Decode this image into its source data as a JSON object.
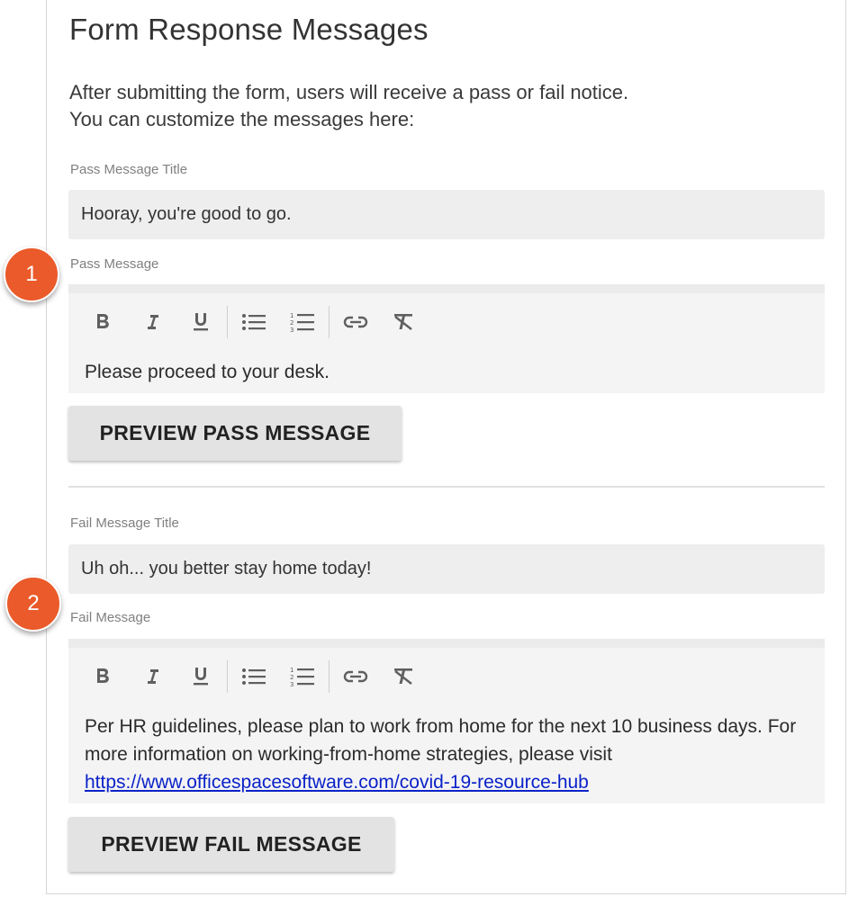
{
  "header": {
    "title": "Form Response Messages",
    "intro_line1": "After submitting the form, users will receive a pass or fail notice.",
    "intro_line2": "You can customize the messages here:"
  },
  "pass": {
    "title_label": "Pass Message Title",
    "title_value": "Hooray, you're good to go.",
    "message_label": "Pass Message",
    "message_body": "Please proceed to your desk.",
    "preview_button": "PREVIEW PASS MESSAGE"
  },
  "fail": {
    "title_label": "Fail Message Title",
    "title_value": "Uh oh... you better stay home today!",
    "message_label": "Fail Message",
    "message_body": "Per HR guidelines, please plan to work from home for the next 10 business days.  For more information on working-from-home strategies, please visit",
    "message_link": "https://www.officespacesoftware.com/covid-19-resource-hub",
    "preview_button": "PREVIEW FAIL MESSAGE"
  },
  "toolbar_icons": [
    "bold-icon",
    "italic-icon",
    "underline-icon",
    "bulleted-list-icon",
    "numbered-list-icon",
    "link-icon",
    "clear-format-icon"
  ],
  "callouts": {
    "one": "1",
    "two": "2"
  },
  "colors": {
    "badge": "#ea5a2a",
    "link": "#0b22c8",
    "input_bg": "#eeeeee",
    "editor_bg": "#f4f4f4",
    "button_bg": "#e3e3e3"
  }
}
